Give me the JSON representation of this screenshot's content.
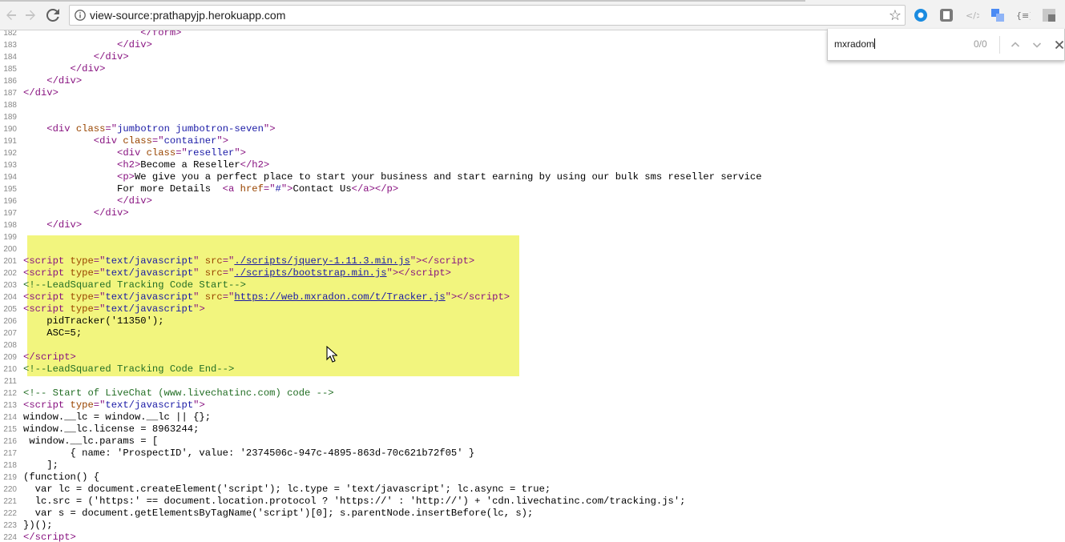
{
  "browser": {
    "url": "view-source:prathapyjp.herokuapp.com",
    "back_icon": "arrow-left-icon",
    "forward_icon": "arrow-right-icon",
    "reload_icon": "reload-icon",
    "bookmark_icon": "star-icon"
  },
  "find_bar": {
    "query": "mxradom",
    "count": "0/0"
  },
  "source_lines": [
    {
      "n": "182",
      "html": "                    <span class=\"tag\">&lt;/form&gt;</span>"
    },
    {
      "n": "183",
      "html": "                <span class=\"tag\">&lt;/div&gt;</span>"
    },
    {
      "n": "184",
      "html": "            <span class=\"tag\">&lt;/div&gt;</span>"
    },
    {
      "n": "185",
      "html": "        <span class=\"tag\">&lt;/div&gt;</span>"
    },
    {
      "n": "186",
      "html": "    <span class=\"tag\">&lt;/div&gt;</span>"
    },
    {
      "n": "187",
      "html": "<span class=\"tag\">&lt;/div&gt;</span>"
    },
    {
      "n": "188",
      "html": ""
    },
    {
      "n": "189",
      "html": ""
    },
    {
      "n": "190",
      "html": "    <span class=\"tag\">&lt;div <span class=\"attr\">class</span>=\"<span class=\"val\">jumbotron jumbotron-seven</span>\"&gt;</span>"
    },
    {
      "n": "191",
      "html": "            <span class=\"tag\">&lt;div <span class=\"attr\">class</span>=\"<span class=\"val\">container</span>\"&gt;</span>"
    },
    {
      "n": "192",
      "html": "                <span class=\"tag\">&lt;div <span class=\"attr\">class</span>=\"<span class=\"val\">reseller</span>\"&gt;</span>"
    },
    {
      "n": "193",
      "html": "                <span class=\"tag\">&lt;h2&gt;</span>Become a Reseller<span class=\"tag\">&lt;/h2&gt;</span>"
    },
    {
      "n": "194",
      "html": "                <span class=\"tag\">&lt;p&gt;</span>We give you a perfect place to start your business and start earning by using our bulk sms reseller service"
    },
    {
      "n": "195",
      "html": "                For more Details  <span class=\"tag\">&lt;a <span class=\"attr\">href</span>=\"<span class=\"val\">#</span>\"&gt;</span>Contact Us<span class=\"tag\">&lt;/a&gt;&lt;/p&gt;</span>"
    },
    {
      "n": "196",
      "html": "                <span class=\"tag\">&lt;/div&gt;</span>"
    },
    {
      "n": "197",
      "html": "            <span class=\"tag\">&lt;/div&gt;</span>"
    },
    {
      "n": "198",
      "html": "    <span class=\"tag\">&lt;/div&gt;</span>"
    },
    {
      "n": "199",
      "html": ""
    },
    {
      "n": "200",
      "html": ""
    },
    {
      "n": "201",
      "html": "<span class=\"tag\">&lt;script <span class=\"attr\">type</span>=\"<span class=\"val\">text/javascript</span>\" <span class=\"attr\">src</span>=\"<span class=\"lnk\">./scripts/jquery-1.11.3.min.js</span>\"&gt;&lt;/script&gt;</span>"
    },
    {
      "n": "202",
      "html": "<span class=\"tag\">&lt;script <span class=\"attr\">type</span>=\"<span class=\"val\">text/javascript</span>\" <span class=\"attr\">src</span>=\"<span class=\"lnk\">./scripts/bootstrap.min.js</span>\"&gt;&lt;/script&gt;</span>"
    },
    {
      "n": "203",
      "html": "<span class=\"cmt\">&lt;!--LeadSquared Tracking Code Start--&gt;</span>"
    },
    {
      "n": "204",
      "html": "<span class=\"tag\">&lt;script <span class=\"attr\">type</span>=\"<span class=\"val\">text/javascript</span>\" <span class=\"attr\">src</span>=\"<span class=\"lnk\">https://web.mxradon.com/t/Tracker.js</span>\"&gt;&lt;/script&gt;</span>"
    },
    {
      "n": "205",
      "html": "<span class=\"tag\">&lt;script <span class=\"attr\">type</span>=\"<span class=\"val\">text/javascript</span>\"&gt;</span>"
    },
    {
      "n": "206",
      "html": "    pidTracker('11350');"
    },
    {
      "n": "207",
      "html": "    ASC=5;"
    },
    {
      "n": "208",
      "html": ""
    },
    {
      "n": "209",
      "html": "<span class=\"tag\">&lt;/script&gt;</span>"
    },
    {
      "n": "210",
      "html": "<span class=\"cmt\">&lt;!--LeadSquared Tracking Code End--&gt;</span>"
    },
    {
      "n": "211",
      "html": ""
    },
    {
      "n": "212",
      "html": "<span class=\"cmt\">&lt;!-- Start of LiveChat (www.livechatinc.com) code --&gt;</span>"
    },
    {
      "n": "213",
      "html": "<span class=\"tag\">&lt;script <span class=\"attr\">type</span>=\"<span class=\"val\">text/javascript</span>\"&gt;</span>"
    },
    {
      "n": "214",
      "html": "window.__lc = window.__lc || {};"
    },
    {
      "n": "215",
      "html": "window.__lc.license = 8963244;"
    },
    {
      "n": "216",
      "html": " window.__lc.params = ["
    },
    {
      "n": "217",
      "html": "        { name: 'ProspectID', value: '2374506c-947c-4895-863d-70c621b72f05' }"
    },
    {
      "n": "218",
      "html": "    ];"
    },
    {
      "n": "219",
      "html": "(function() {"
    },
    {
      "n": "220",
      "html": "  var lc = document.createElement('script'); lc.type = 'text/javascript'; lc.async = true;"
    },
    {
      "n": "221",
      "html": "  lc.src = ('https:' == document.location.protocol ? 'https://' : 'http://') + 'cdn.livechatinc.com/tracking.js';"
    },
    {
      "n": "222",
      "html": "  var s = document.getElementsByTagName('script')[0]; s.parentNode.insertBefore(lc, s);"
    },
    {
      "n": "223",
      "html": "})();"
    },
    {
      "n": "224",
      "html": "<span class=\"tag\">&lt;/script&gt;</span>"
    }
  ]
}
